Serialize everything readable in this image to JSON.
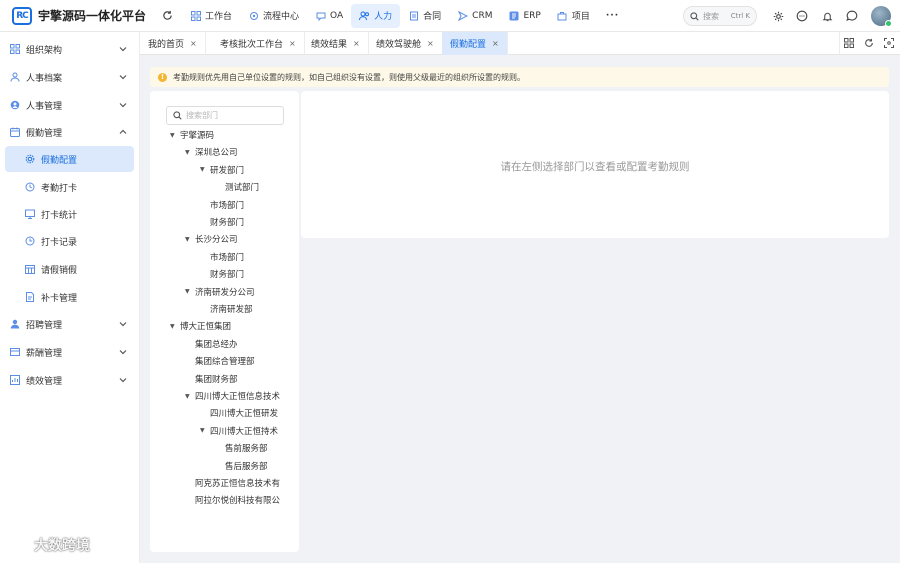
{
  "header": {
    "logo_text": "RC",
    "title": "宇擎源码一体化平台",
    "nav": [
      {
        "label": "工作台",
        "icon": "grid-icon"
      },
      {
        "label": "流程中心",
        "icon": "flow-icon"
      },
      {
        "label": "OA",
        "icon": "oa-icon"
      },
      {
        "label": "人力",
        "icon": "people-icon",
        "active": true
      },
      {
        "label": "合同",
        "icon": "contract-icon"
      },
      {
        "label": "CRM",
        "icon": "crm-icon"
      },
      {
        "label": "ERP",
        "icon": "erp-icon"
      },
      {
        "label": "项目",
        "icon": "project-icon"
      }
    ],
    "more": "···",
    "search_placeholder": "搜索",
    "search_shortcut": "Ctrl K"
  },
  "sidebar": {
    "items": [
      {
        "label": "组织架构",
        "icon": "org-icon",
        "expanded": false
      },
      {
        "label": "人事档案",
        "icon": "user-icon",
        "expanded": false
      },
      {
        "label": "人事管理",
        "icon": "user-circle-icon",
        "expanded": false
      },
      {
        "label": "假勤管理",
        "icon": "calendar-icon",
        "expanded": true
      },
      {
        "label": "招聘管理",
        "icon": "recruit-icon",
        "expanded": false
      },
      {
        "label": "薪酬管理",
        "icon": "salary-icon",
        "expanded": false
      },
      {
        "label": "绩效管理",
        "icon": "performance-icon",
        "expanded": false
      }
    ],
    "sub_items": [
      {
        "label": "假勤配置",
        "icon": "settings-icon",
        "active": true
      },
      {
        "label": "考勤打卡",
        "icon": "clock-icon"
      },
      {
        "label": "打卡统计",
        "icon": "stats-icon"
      },
      {
        "label": "打卡记录",
        "icon": "record-icon"
      },
      {
        "label": "请假销假",
        "icon": "leave-icon"
      },
      {
        "label": "补卡管理",
        "icon": "doc-icon"
      }
    ]
  },
  "tabs": [
    {
      "label": "我的首页",
      "close": "×"
    },
    {
      "label": "考核批次工作台",
      "close": "×"
    },
    {
      "label": "绩效结果",
      "close": "×"
    },
    {
      "label": "绩效驾驶舱",
      "close": "×"
    },
    {
      "label": "假勤配置",
      "close": "×",
      "active": true
    }
  ],
  "notice": {
    "icon": "!",
    "text": "考勤规则优先用自己单位设置的规则，如自己组织没有设置，则使用父级最近的组织所设置的规则。"
  },
  "tree": {
    "search_placeholder": "搜索部门",
    "nodes": [
      {
        "label": "宇擎源码",
        "level": 0,
        "expandable": true
      },
      {
        "label": "深圳总公司",
        "level": 1,
        "expandable": true
      },
      {
        "label": "研发部门",
        "level": 2,
        "expandable": true
      },
      {
        "label": "测试部门",
        "level": 3,
        "expandable": false
      },
      {
        "label": "市场部门",
        "level": 2,
        "expandable": false
      },
      {
        "label": "财务部门",
        "level": 2,
        "expandable": false
      },
      {
        "label": "长沙分公司",
        "level": 1,
        "expandable": true
      },
      {
        "label": "市场部门",
        "level": 2,
        "expandable": false
      },
      {
        "label": "财务部门",
        "level": 2,
        "expandable": false
      },
      {
        "label": "济南研发分公司",
        "level": 1,
        "expandable": true
      },
      {
        "label": "济南研发部",
        "level": 2,
        "expandable": false
      },
      {
        "label": "博大正恒集团",
        "level": 0,
        "expandable": true
      },
      {
        "label": "集团总经办",
        "level": 1,
        "expandable": false
      },
      {
        "label": "集团综合管理部",
        "level": 1,
        "expandable": false
      },
      {
        "label": "集团财务部",
        "level": 1,
        "expandable": false
      },
      {
        "label": "四川博大正恒信息技术",
        "level": 1,
        "expandable": true
      },
      {
        "label": "四川博大正恒研发",
        "level": 2,
        "expandable": false
      },
      {
        "label": "四川博大正恒持术",
        "level": 2,
        "expandable": true
      },
      {
        "label": "售前服务部",
        "level": 3,
        "expandable": false
      },
      {
        "label": "售后服务部",
        "level": 3,
        "expandable": false
      },
      {
        "label": "阿克苏正恒信息技术有",
        "level": 1,
        "expandable": false
      },
      {
        "label": "阿拉尔悦创科技有限公",
        "level": 1,
        "expandable": false
      }
    ]
  },
  "main": {
    "empty_text": "请在左侧选择部门以查看或配置考勤规则"
  },
  "watermark": {
    "text": "大数跨境"
  },
  "colors": {
    "accent": "#1a6fe0",
    "active_bg": "#dce8fb",
    "notice_bg": "#fdf8e7",
    "notice_icon": "#f2b630"
  }
}
